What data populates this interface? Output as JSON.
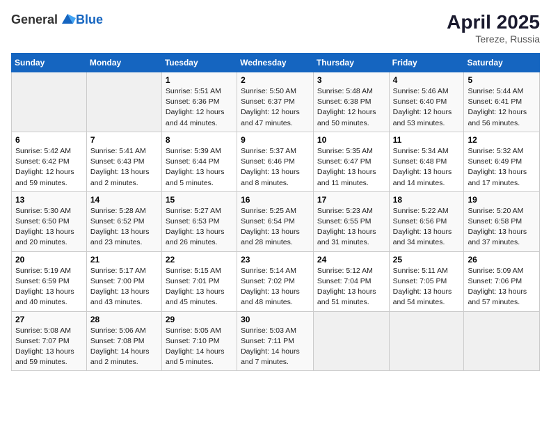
{
  "header": {
    "logo_general": "General",
    "logo_blue": "Blue",
    "month_year": "April 2025",
    "location": "Tereze, Russia"
  },
  "weekdays": [
    "Sunday",
    "Monday",
    "Tuesday",
    "Wednesday",
    "Thursday",
    "Friday",
    "Saturday"
  ],
  "weeks": [
    [
      {
        "day": "",
        "info": ""
      },
      {
        "day": "",
        "info": ""
      },
      {
        "day": "1",
        "info": "Sunrise: 5:51 AM\nSunset: 6:36 PM\nDaylight: 12 hours and 44 minutes."
      },
      {
        "day": "2",
        "info": "Sunrise: 5:50 AM\nSunset: 6:37 PM\nDaylight: 12 hours and 47 minutes."
      },
      {
        "day": "3",
        "info": "Sunrise: 5:48 AM\nSunset: 6:38 PM\nDaylight: 12 hours and 50 minutes."
      },
      {
        "day": "4",
        "info": "Sunrise: 5:46 AM\nSunset: 6:40 PM\nDaylight: 12 hours and 53 minutes."
      },
      {
        "day": "5",
        "info": "Sunrise: 5:44 AM\nSunset: 6:41 PM\nDaylight: 12 hours and 56 minutes."
      }
    ],
    [
      {
        "day": "6",
        "info": "Sunrise: 5:42 AM\nSunset: 6:42 PM\nDaylight: 12 hours and 59 minutes."
      },
      {
        "day": "7",
        "info": "Sunrise: 5:41 AM\nSunset: 6:43 PM\nDaylight: 13 hours and 2 minutes."
      },
      {
        "day": "8",
        "info": "Sunrise: 5:39 AM\nSunset: 6:44 PM\nDaylight: 13 hours and 5 minutes."
      },
      {
        "day": "9",
        "info": "Sunrise: 5:37 AM\nSunset: 6:46 PM\nDaylight: 13 hours and 8 minutes."
      },
      {
        "day": "10",
        "info": "Sunrise: 5:35 AM\nSunset: 6:47 PM\nDaylight: 13 hours and 11 minutes."
      },
      {
        "day": "11",
        "info": "Sunrise: 5:34 AM\nSunset: 6:48 PM\nDaylight: 13 hours and 14 minutes."
      },
      {
        "day": "12",
        "info": "Sunrise: 5:32 AM\nSunset: 6:49 PM\nDaylight: 13 hours and 17 minutes."
      }
    ],
    [
      {
        "day": "13",
        "info": "Sunrise: 5:30 AM\nSunset: 6:50 PM\nDaylight: 13 hours and 20 minutes."
      },
      {
        "day": "14",
        "info": "Sunrise: 5:28 AM\nSunset: 6:52 PM\nDaylight: 13 hours and 23 minutes."
      },
      {
        "day": "15",
        "info": "Sunrise: 5:27 AM\nSunset: 6:53 PM\nDaylight: 13 hours and 26 minutes."
      },
      {
        "day": "16",
        "info": "Sunrise: 5:25 AM\nSunset: 6:54 PM\nDaylight: 13 hours and 28 minutes."
      },
      {
        "day": "17",
        "info": "Sunrise: 5:23 AM\nSunset: 6:55 PM\nDaylight: 13 hours and 31 minutes."
      },
      {
        "day": "18",
        "info": "Sunrise: 5:22 AM\nSunset: 6:56 PM\nDaylight: 13 hours and 34 minutes."
      },
      {
        "day": "19",
        "info": "Sunrise: 5:20 AM\nSunset: 6:58 PM\nDaylight: 13 hours and 37 minutes."
      }
    ],
    [
      {
        "day": "20",
        "info": "Sunrise: 5:19 AM\nSunset: 6:59 PM\nDaylight: 13 hours and 40 minutes."
      },
      {
        "day": "21",
        "info": "Sunrise: 5:17 AM\nSunset: 7:00 PM\nDaylight: 13 hours and 43 minutes."
      },
      {
        "day": "22",
        "info": "Sunrise: 5:15 AM\nSunset: 7:01 PM\nDaylight: 13 hours and 45 minutes."
      },
      {
        "day": "23",
        "info": "Sunrise: 5:14 AM\nSunset: 7:02 PM\nDaylight: 13 hours and 48 minutes."
      },
      {
        "day": "24",
        "info": "Sunrise: 5:12 AM\nSunset: 7:04 PM\nDaylight: 13 hours and 51 minutes."
      },
      {
        "day": "25",
        "info": "Sunrise: 5:11 AM\nSunset: 7:05 PM\nDaylight: 13 hours and 54 minutes."
      },
      {
        "day": "26",
        "info": "Sunrise: 5:09 AM\nSunset: 7:06 PM\nDaylight: 13 hours and 57 minutes."
      }
    ],
    [
      {
        "day": "27",
        "info": "Sunrise: 5:08 AM\nSunset: 7:07 PM\nDaylight: 13 hours and 59 minutes."
      },
      {
        "day": "28",
        "info": "Sunrise: 5:06 AM\nSunset: 7:08 PM\nDaylight: 14 hours and 2 minutes."
      },
      {
        "day": "29",
        "info": "Sunrise: 5:05 AM\nSunset: 7:10 PM\nDaylight: 14 hours and 5 minutes."
      },
      {
        "day": "30",
        "info": "Sunrise: 5:03 AM\nSunset: 7:11 PM\nDaylight: 14 hours and 7 minutes."
      },
      {
        "day": "",
        "info": ""
      },
      {
        "day": "",
        "info": ""
      },
      {
        "day": "",
        "info": ""
      }
    ]
  ]
}
